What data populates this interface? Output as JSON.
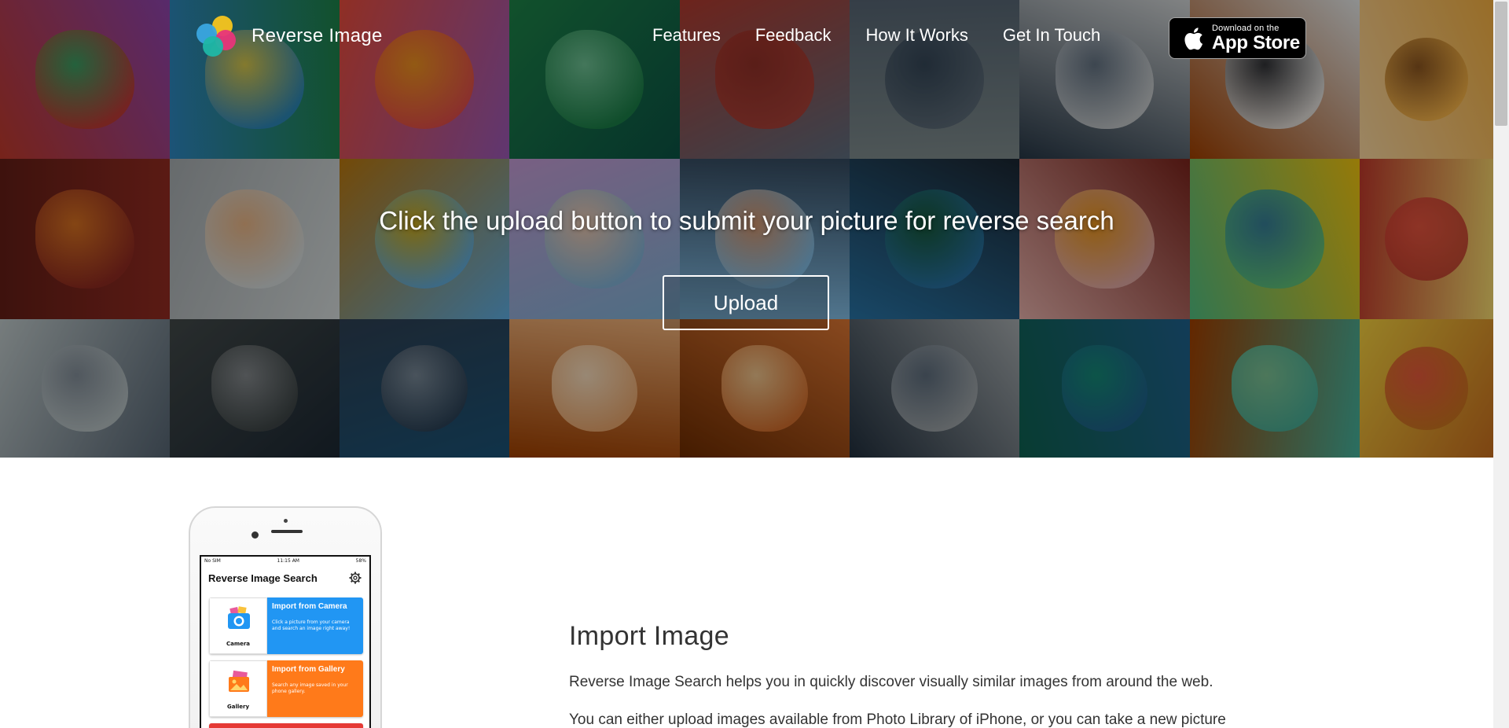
{
  "brand": {
    "name": "Reverse Image"
  },
  "nav": {
    "links": [
      "Features",
      "Feedback",
      "How It Works",
      "Get In Touch"
    ]
  },
  "appstore": {
    "small": "Download on the",
    "big": "App Store"
  },
  "hero": {
    "title": "Click the upload button to submit your picture for reverse search",
    "upload_label": "Upload"
  },
  "phone_app": {
    "status_left": "No SIM",
    "status_time": "11:15 AM",
    "status_right": "58%",
    "title": "Reverse Image Search",
    "cards": [
      {
        "label": "Camera",
        "title": "Import from Camera",
        "desc": "Click a picture from your camera and search an image right away!",
        "color": "#2196f3"
      },
      {
        "label": "Gallery",
        "title": "Import from Gallery",
        "desc": "Search any image saved in your phone gallery.",
        "color": "#ff7a1a"
      }
    ]
  },
  "section": {
    "title": "Import Image",
    "p1": "Reverse Image Search helps you in quickly discover visually similar images from around the web.",
    "p2": "You can either upload images available from Photo Library of iPhone, or you can take a new picture"
  },
  "colors": {
    "camera_card": "#2196f3",
    "gallery_card": "#ff7a1a"
  }
}
